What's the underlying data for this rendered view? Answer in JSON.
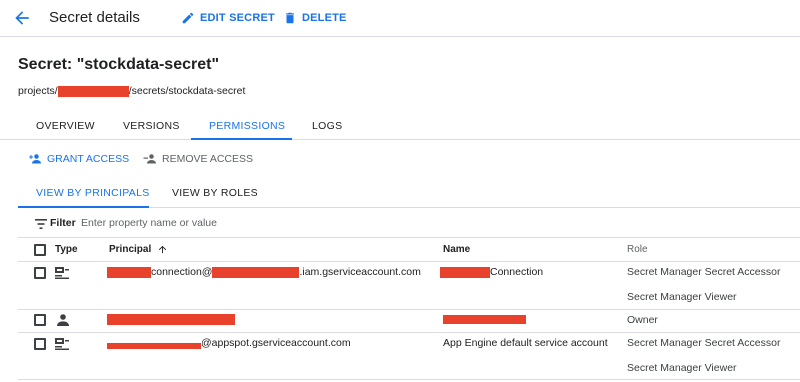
{
  "header": {
    "title": "Secret details",
    "edit_label": "EDIT SECRET",
    "delete_label": "DELETE"
  },
  "secret": {
    "title": "Secret: \"stockdata-secret\"",
    "path_prefix": "projects/",
    "path_suffix": "/secrets/stockdata-secret"
  },
  "tabs": [
    {
      "label": "OVERVIEW"
    },
    {
      "label": "VERSIONS"
    },
    {
      "label": "PERMISSIONS",
      "active": true
    },
    {
      "label": "LOGS"
    }
  ],
  "actions": {
    "grant_label": "GRANT ACCESS",
    "remove_label": "REMOVE ACCESS"
  },
  "subtabs": [
    {
      "label": "VIEW BY PRINCIPALS",
      "active": true
    },
    {
      "label": "VIEW BY ROLES"
    }
  ],
  "filter": {
    "label": "Filter",
    "placeholder": "Enter property name or value"
  },
  "table": {
    "columns": {
      "type": "Type",
      "principal": "Principal",
      "name": "Name",
      "role": "Role"
    },
    "rows": [
      {
        "type_icon": "service-account-icon",
        "principal_part1": "connection@",
        "principal_part2": ".iam.gserviceaccount.com",
        "name_text": "Connection",
        "roles": [
          "Secret Manager Secret Accessor",
          "Secret Manager Viewer"
        ]
      },
      {
        "type_icon": "person-icon",
        "principal_part1": "",
        "principal_part2": "",
        "name_text": "",
        "roles": [
          "Owner"
        ]
      },
      {
        "type_icon": "service-account-icon",
        "principal_part1": "@appspot.gserviceaccount.com",
        "principal_part2": "",
        "name_text": "App Engine default service account",
        "roles": [
          "Secret Manager Secret Accessor",
          "Secret Manager Viewer"
        ]
      }
    ]
  },
  "colors": {
    "accent": "#1a73e8",
    "redaction": "#e8412c",
    "divider": "#dadce0"
  }
}
